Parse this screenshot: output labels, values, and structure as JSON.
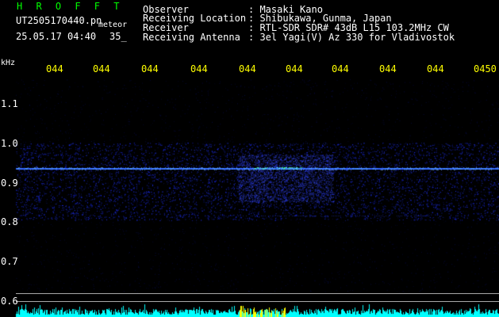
{
  "header": {
    "station": "H R O F F T",
    "filename": "UT2505170440.pn",
    "type": "meteor",
    "datetime": "25.05.17 04:40",
    "count": "35_"
  },
  "info": {
    "labels": [
      "Observer",
      "Receiving Location",
      "Receiver",
      "Receiving Antenna"
    ],
    "values": [
      ": Masaki Kano",
      ": Shibukawa, Gunma, Japan",
      ": RTL-SDR SDR# 43dB L15 103.2MHz CW",
      ": 3el Yagi(V) Az 330 for Vladivostok"
    ]
  },
  "time_axis": {
    "ticks": [
      "044",
      "044",
      "044",
      "044",
      "044",
      "044",
      "044",
      "044",
      "044",
      "0450"
    ]
  },
  "freq_axis": {
    "unit": "kHz",
    "ticks": [
      "1.1",
      "1.0",
      "0.9",
      "0.8",
      "0.7",
      "0.6"
    ]
  },
  "colors": {
    "background": "#000000",
    "label_text": "#ffffff",
    "time_ticks": "#ffff00",
    "station_name": "#00ff00",
    "signal_core": "#00ffff",
    "noise": "#1c2cd8"
  }
}
